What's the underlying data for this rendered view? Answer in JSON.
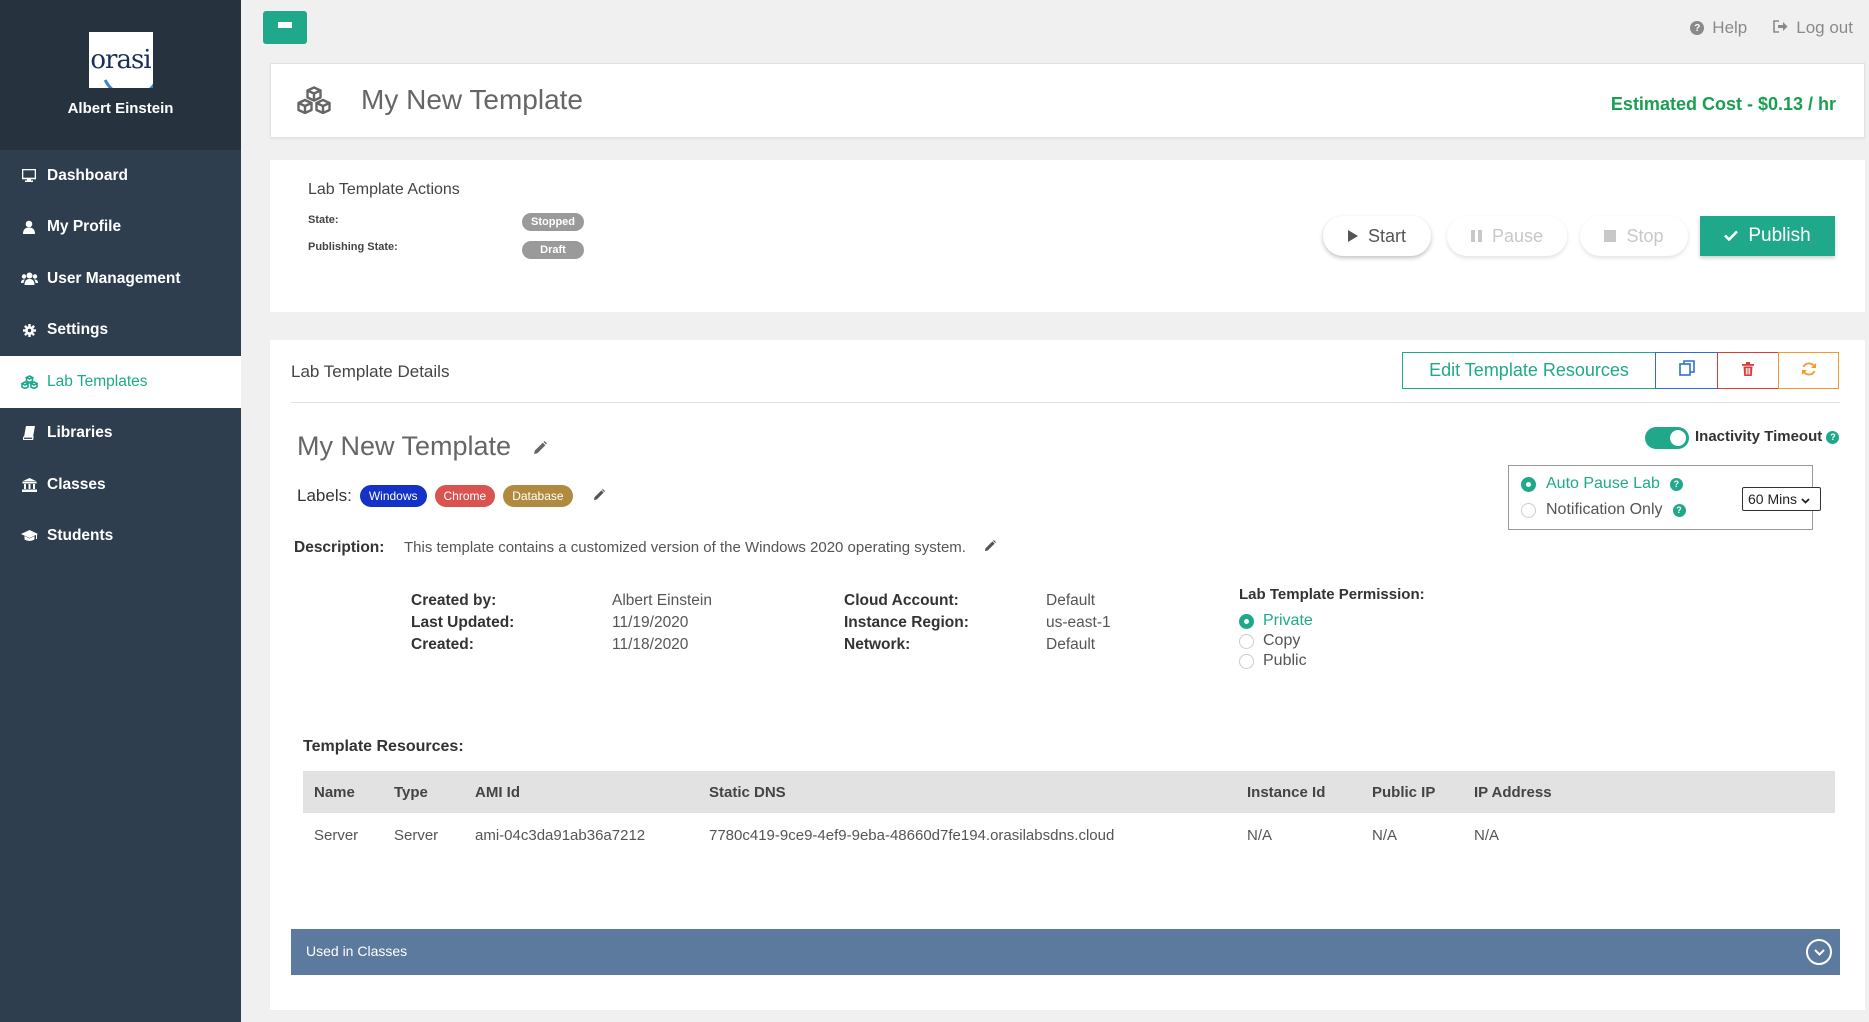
{
  "sidebar": {
    "logo_text": "orasi",
    "user_name": "Albert Einstein",
    "items": [
      {
        "label": "Dashboard",
        "icon": "monitor-icon"
      },
      {
        "label": "My Profile",
        "icon": "user-icon"
      },
      {
        "label": "User Management",
        "icon": "users-icon"
      },
      {
        "label": "Settings",
        "icon": "gear-icon"
      },
      {
        "label": "Lab Templates",
        "icon": "cubes-icon",
        "active": true
      },
      {
        "label": "Libraries",
        "icon": "book-icon"
      },
      {
        "label": "Classes",
        "icon": "institution-icon"
      },
      {
        "label": "Students",
        "icon": "graduation-cap-icon"
      }
    ]
  },
  "topbar": {
    "help_label": "Help",
    "logout_label": "Log out"
  },
  "header": {
    "title": "My New Template",
    "estimated_cost": "Estimated Cost - $0.13 / hr"
  },
  "actions": {
    "title": "Lab Template Actions",
    "state_label": "State:",
    "state_value": "Stopped",
    "publishing_label": "Publishing State:",
    "publishing_value": "Draft",
    "start_label": "Start",
    "pause_label": "Pause",
    "stop_label": "Stop",
    "publish_label": "Publish"
  },
  "details": {
    "header": "Lab Template Details",
    "edit_resources_label": "Edit Template Resources",
    "name": "My New Template",
    "labels_title": "Labels:",
    "labels": [
      {
        "text": "Windows",
        "color": "#1432c8"
      },
      {
        "text": "Chrome",
        "color": "#d9534f"
      },
      {
        "text": "Database",
        "color": "#b08a3e"
      }
    ],
    "description_label": "Description:",
    "description": "This template contains a customized version of the Windows 2020 operating system.",
    "created_by_label": "Created by:",
    "created_by": "Albert Einstein",
    "last_updated_label": "Last Updated:",
    "last_updated": "11/19/2020",
    "created_label": "Created:",
    "created": "11/18/2020",
    "cloud_account_label": "Cloud Account:",
    "cloud_account": "Default",
    "instance_region_label": "Instance Region:",
    "instance_region": "us-east-1",
    "network_label": "Network:",
    "network": "Default",
    "permission_title": "Lab Template Permission:",
    "permission_options": [
      "Private",
      "Copy",
      "Public"
    ],
    "permission_selected": "Private",
    "inactivity_label": "Inactivity Timeout",
    "inactivity_enabled": true,
    "auto_pause_label": "Auto Pause Lab",
    "notification_only_label": "Notification Only",
    "timeout_value": "60 Mins"
  },
  "resources": {
    "title": "Template Resources:",
    "columns": [
      "Name",
      "Type",
      "AMI Id",
      "Static DNS",
      "Instance Id",
      "Public IP",
      "IP Address"
    ],
    "rows": [
      [
        "Server",
        "Server",
        "ami-04c3da91ab36a7212",
        "7780c419-9ce9-4ef9-9eba-48660d7fe194.orasilabsdns.cloud",
        "N/A",
        "N/A",
        "N/A"
      ]
    ]
  },
  "used_in_classes": {
    "label": "Used in Classes"
  },
  "colors": {
    "accent": "#1fa98a",
    "sidebar": "#2e3e4e",
    "cost": "#1a9e50",
    "used_bar": "#5b7a9d"
  }
}
